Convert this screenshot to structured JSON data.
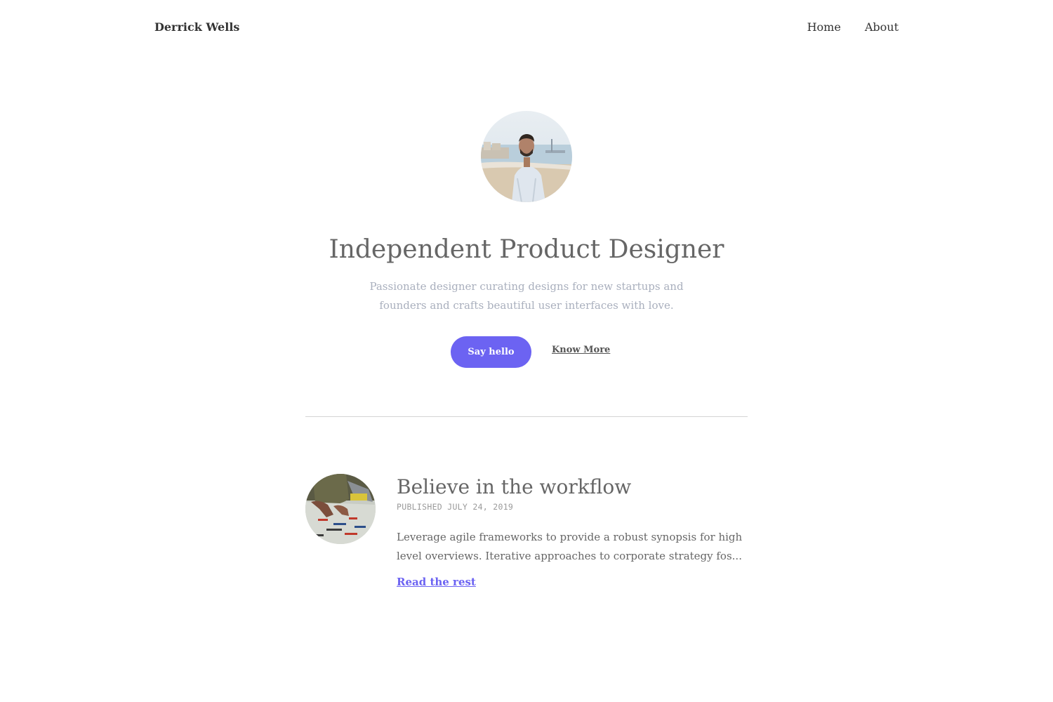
{
  "header": {
    "brand": "Derrick Wells",
    "nav": [
      "Home",
      "About"
    ]
  },
  "hero": {
    "avatar_icon": "portrait-photo",
    "title": "Independent Product Designer",
    "subtitle": "Passionate designer curating designs for new startups and founders and crafts beautiful user interfaces with love.",
    "primary_button": "Say hello",
    "secondary_link": "Know More"
  },
  "posts": [
    {
      "thumbnail_icon": "workshop-photo",
      "title": "Believe in the workflow",
      "date": "PUBLISHED JULY 24, 2019",
      "excerpt": "Leverage agile frameworks to provide a robust synopsis for high level overviews. Iterative approaches to corporate strategy fos...",
      "link": "Read the rest"
    }
  ],
  "colors": {
    "accent": "#6c63f2",
    "text": "#333333",
    "muted": "#a9afbd",
    "divider": "#d4d4d4"
  }
}
